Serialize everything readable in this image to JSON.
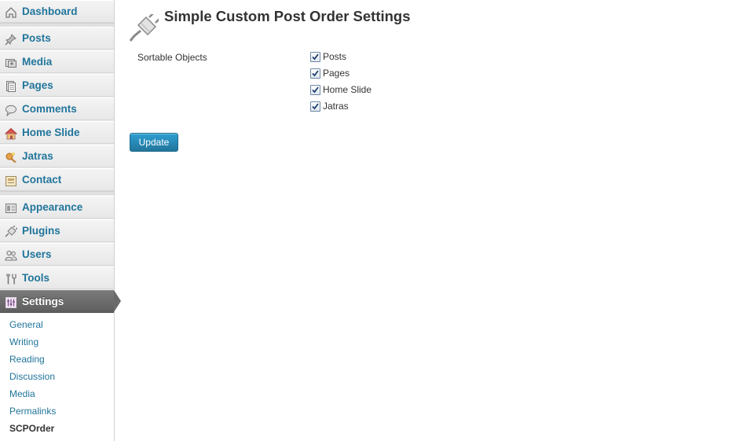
{
  "sidebar": {
    "items": [
      {
        "label": "Dashboard",
        "icon": "dashboard-icon"
      },
      {
        "label": "Posts",
        "icon": "pushpin-icon"
      },
      {
        "label": "Media",
        "icon": "media-icon"
      },
      {
        "label": "Pages",
        "icon": "pages-icon"
      },
      {
        "label": "Comments",
        "icon": "comment-icon"
      },
      {
        "label": "Home Slide",
        "icon": "home-icon"
      },
      {
        "label": "Jatras",
        "icon": "jatras-icon"
      },
      {
        "label": "Contact",
        "icon": "contact-icon"
      },
      {
        "label": "Appearance",
        "icon": "appearance-icon"
      },
      {
        "label": "Plugins",
        "icon": "plugin-icon"
      },
      {
        "label": "Users",
        "icon": "users-icon"
      },
      {
        "label": "Tools",
        "icon": "tools-icon"
      },
      {
        "label": "Settings",
        "icon": "settings-icon"
      }
    ],
    "submenu": [
      "General",
      "Writing",
      "Reading",
      "Discussion",
      "Media",
      "Permalinks",
      "SCPOrder"
    ]
  },
  "main": {
    "title": "Simple Custom Post Order Settings",
    "field_label": "Sortable Objects",
    "options": [
      {
        "label": "Posts",
        "checked": true
      },
      {
        "label": "Pages",
        "checked": true
      },
      {
        "label": "Home Slide",
        "checked": true
      },
      {
        "label": "Jatras",
        "checked": true
      }
    ],
    "submit_label": "Update"
  },
  "colors": {
    "link": "#21759b",
    "button": "#21759b",
    "current_menu": "#6a6a6a"
  }
}
